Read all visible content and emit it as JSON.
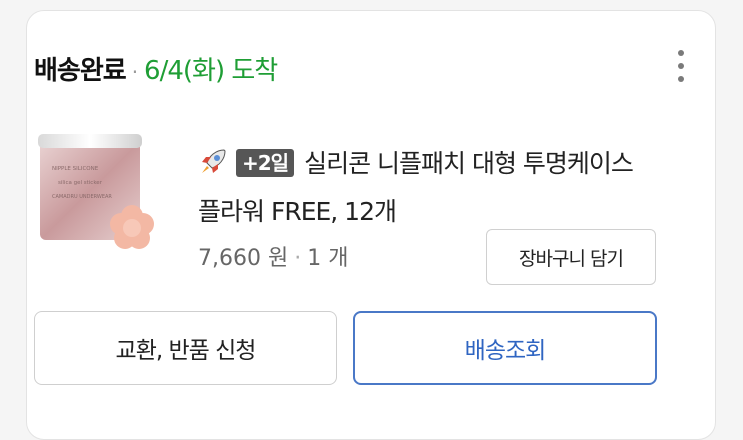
{
  "order": {
    "status": "배송완료",
    "separator": "·",
    "arrival": "6/4(화) 도착"
  },
  "product": {
    "rocket_icon": "rocket-delivery-icon",
    "delivery_badge": "+2일",
    "name": "실리콘 니플패치 대형 투명케이스 플라워 FREE, 12개",
    "price": "7,660 원",
    "dot": "·",
    "quantity": "1 개",
    "image_text_line1": "NIPPLE SILICONE",
    "image_text_line2": "silica gel sticker",
    "image_text_line3": "CAMADRU UNDERWEAR"
  },
  "buttons": {
    "add_to_cart": "장바구니 담기",
    "return_exchange": "교환, 반품 신청",
    "track_delivery": "배송조회"
  },
  "colors": {
    "arrival_green": "#1f9e35",
    "track_blue": "#2f65c2"
  }
}
